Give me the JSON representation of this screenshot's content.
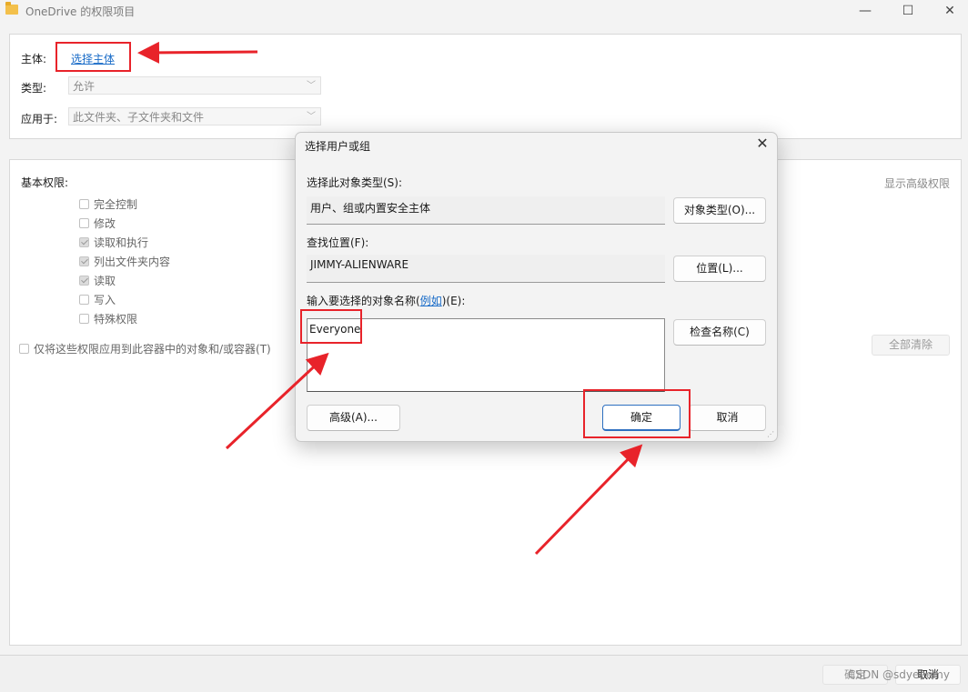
{
  "window": {
    "title": "OneDrive 的权限项目",
    "minimize": "—",
    "maximize": "☐",
    "close": "✕"
  },
  "top_panel": {
    "principal_label": "主体:",
    "principal_link": "选择主体",
    "type_label": "类型:",
    "type_value": "允许",
    "applies_label": "应用于:",
    "applies_value": "此文件夹、子文件夹和文件"
  },
  "main_panel": {
    "basic_permissions_label": "基本权限:",
    "show_advanced": "显示高级权限",
    "permissions": [
      {
        "label": "完全控制",
        "checked": false
      },
      {
        "label": "修改",
        "checked": false
      },
      {
        "label": "读取和执行",
        "checked": true
      },
      {
        "label": "列出文件夹内容",
        "checked": true
      },
      {
        "label": "读取",
        "checked": true
      },
      {
        "label": "写入",
        "checked": false
      },
      {
        "label": "特殊权限",
        "checked": false
      }
    ],
    "apply_only_label": "仅将这些权限应用到此容器中的对象和/或容器(T)",
    "clear_all": "全部清除"
  },
  "bottom": {
    "ok": "确定",
    "cancel": "取消",
    "watermark": "CSDN @sdyeeemy"
  },
  "dialog": {
    "title": "选择用户或组",
    "close": "✕",
    "object_type_label": "选择此对象类型(S):",
    "object_type_value": "用户、组或内置安全主体",
    "object_types_button": "对象类型(O)...",
    "location_label": "查找位置(F):",
    "location_value": "JIMMY-ALIENWARE",
    "locations_button": "位置(L)...",
    "names_label_prefix": "输入要选择的对象名称(",
    "names_label_link": "例如",
    "names_label_suffix": ")(E):",
    "names_value": "Everyone",
    "check_names_button": "检查名称(C)",
    "advanced_button": "高级(A)...",
    "ok_button": "确定",
    "cancel_button": "取消"
  },
  "colors": {
    "annotation_red": "#e8232a",
    "link_blue": "#1a6cc8",
    "primary_border": "#2d6fc0"
  }
}
